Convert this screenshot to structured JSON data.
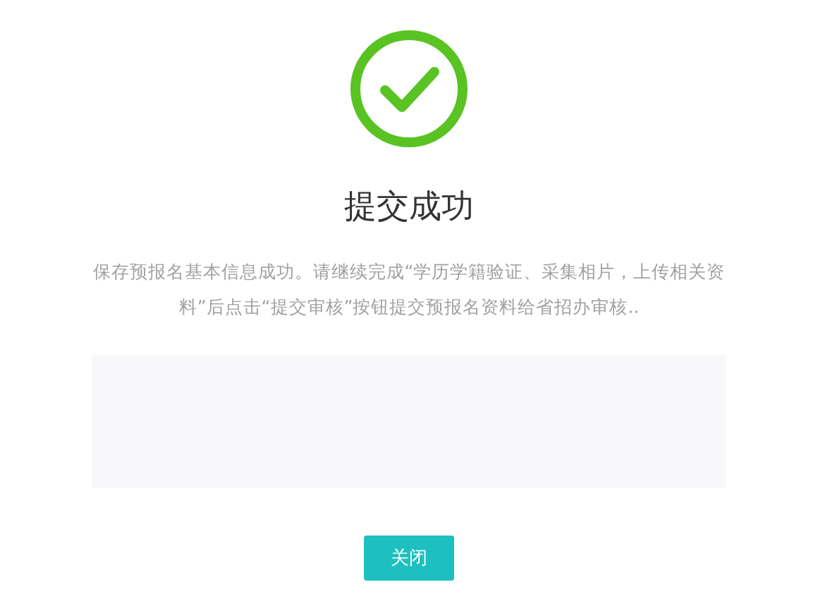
{
  "title": "提交成功",
  "message": "保存预报名基本信息成功。请继续完成“学历学籍验证、采集相片，上传相关资料”后点击“提交审核”按钮提交预报名资料给省招办审核..",
  "buttons": [
    {
      "label": "关闭",
      "kind": "primary"
    }
  ]
}
